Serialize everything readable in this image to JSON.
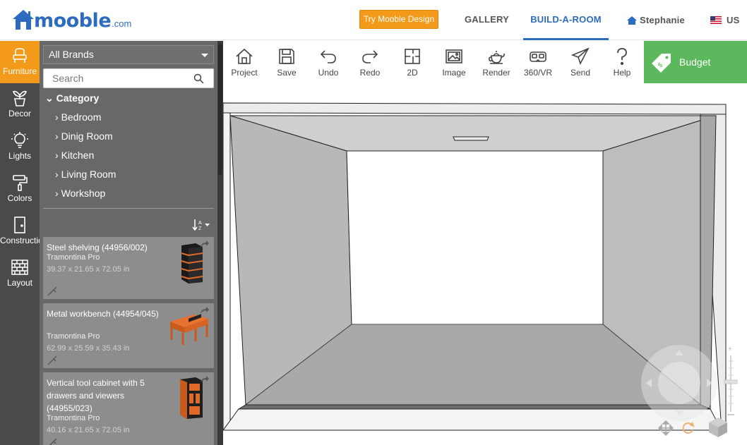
{
  "header": {
    "logo_text": "mooble",
    "logo_domain": ".com",
    "try_button": "Try Mooble Design",
    "nav": {
      "gallery": "GALLERY",
      "build": "BUILD-A-ROOM"
    },
    "user_name": "Stephanie",
    "lang": "US"
  },
  "iconbar": [
    {
      "label": "Furniture",
      "icon": "chair-icon",
      "active": true
    },
    {
      "label": "Decor",
      "icon": "plant-icon"
    },
    {
      "label": "Lights",
      "icon": "bulb-icon"
    },
    {
      "label": "Colors",
      "icon": "paint-roller-icon"
    },
    {
      "label": "Construction",
      "icon": "door-icon"
    },
    {
      "label": "Layout",
      "icon": "brick-wall-icon"
    }
  ],
  "catalog": {
    "brand_select": "All Brands",
    "search_placeholder": "Search",
    "category_heading": "Category",
    "categories": [
      "Bedroom",
      "Dinig Room",
      "Kitchen",
      "Living Room",
      "Workshop"
    ],
    "products": [
      {
        "title": "Steel shelving (44956/002)",
        "brand": "Tramontina Pro",
        "dims": "39.37 x 21.65 x 72.05 in"
      },
      {
        "title": "Metal workbench (44954/045)",
        "brand": "Tramontina Pro",
        "dims": "62.99 x 25.59 x 35.43 in"
      },
      {
        "title": "Vertical tool cabinet with 5 drawers and viewers (44955/023)",
        "brand": "Tramontina Pro",
        "dims": "40.16 x 21.65 x 72.05 in"
      }
    ]
  },
  "toolbar": [
    {
      "label": "Project",
      "icon": "home-icon"
    },
    {
      "label": "Save",
      "icon": "floppy-icon"
    },
    {
      "label": "Undo",
      "icon": "undo-icon"
    },
    {
      "label": "Redo",
      "icon": "redo-icon"
    },
    {
      "label": "2D",
      "icon": "floorplan-icon"
    },
    {
      "label": "Image",
      "icon": "image-icon"
    },
    {
      "label": "Render",
      "icon": "teapot-icon"
    },
    {
      "label": "360/VR",
      "icon": "vr-headset-icon"
    },
    {
      "label": "Send",
      "icon": "paper-plane-icon"
    },
    {
      "label": "Help",
      "icon": "question-icon"
    }
  ],
  "budget_label": "Budget",
  "colors": {
    "accent": "#f39a1b",
    "brand_blue": "#2d6bbf",
    "budget_green": "#5cb85c",
    "panel": "#686868",
    "iconbar": "#4a4a4a"
  }
}
